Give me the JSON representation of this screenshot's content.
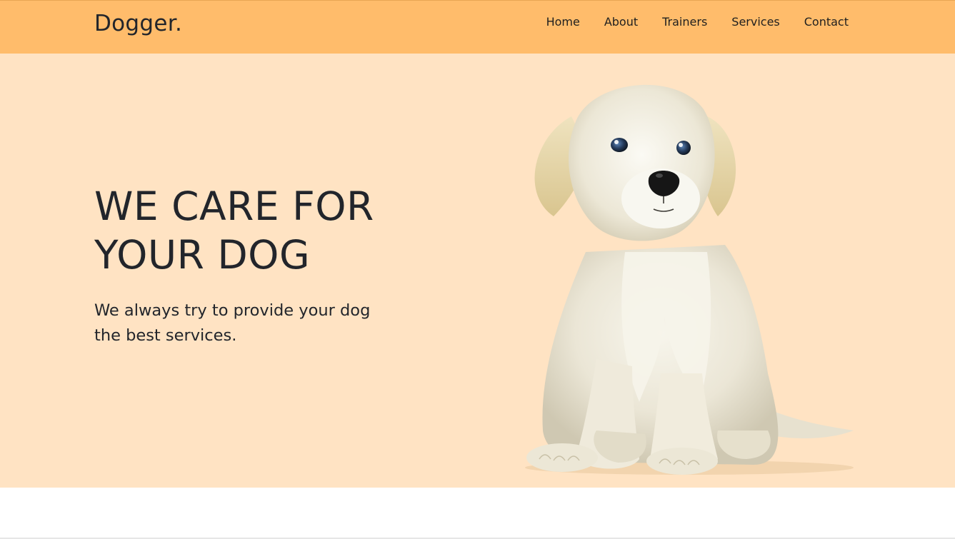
{
  "navbar": {
    "brand": "Dogger.",
    "links": [
      {
        "label": "Home"
      },
      {
        "label": "About"
      },
      {
        "label": "Trainers"
      },
      {
        "label": "Services"
      },
      {
        "label": "Contact"
      }
    ],
    "bg_color": "#ffbc6b"
  },
  "hero": {
    "title_line1": "WE CARE FOR",
    "title_line2": "YOUR DOG",
    "subtitle_line1": "We always try to provide your dog",
    "subtitle_line2": "the best services.",
    "bg_color": "#ffe3c3",
    "image": "puppy-illustration"
  }
}
